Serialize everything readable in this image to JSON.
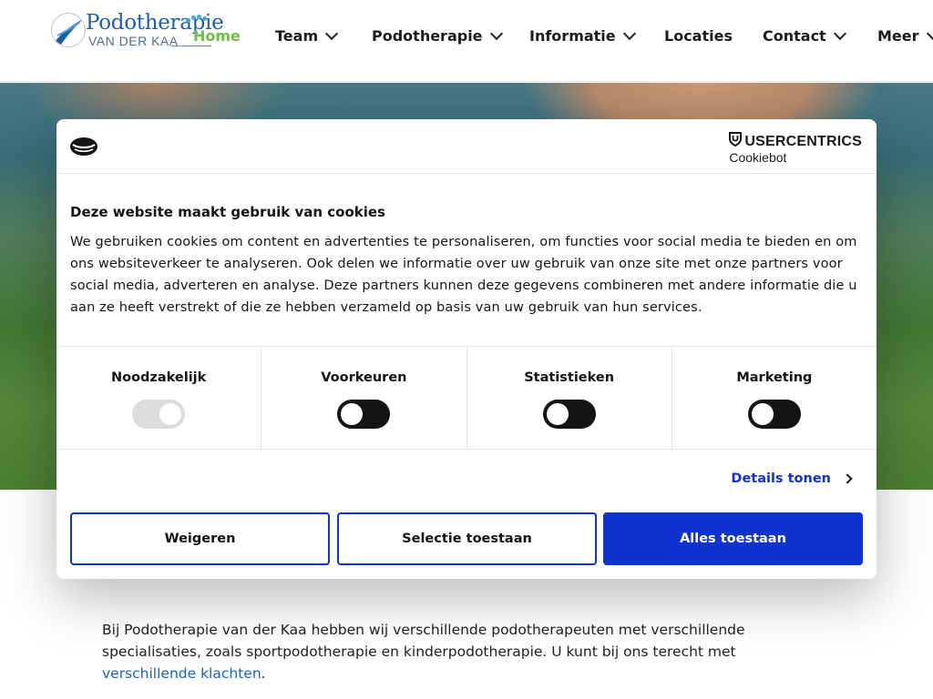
{
  "logo": {
    "title": "Podotherapie",
    "subtitle": "VAN DER KAA"
  },
  "nav": {
    "items": [
      {
        "label": "Home",
        "active": true
      },
      {
        "label": "Team"
      },
      {
        "label": "Podotherapie"
      },
      {
        "label": "Informatie"
      },
      {
        "label": "Locaties"
      },
      {
        "label": "Contact"
      },
      {
        "label": "Meer"
      }
    ]
  },
  "cookie_dialog": {
    "brand_top": "USERCENTRICS",
    "brand_bottom": "Cookiebot",
    "title": "Deze website maakt gebruik van cookies",
    "text": "We gebruiken cookies om content en advertenties te personaliseren, om functies voor social media te bieden en om ons websiteverkeer te analyseren. Ook delen we informatie over uw gebruik van onze site met onze partners voor social media, adverteren en analyse. Deze partners kunnen deze gegevens combineren met andere informatie die u aan ze heeft verstrekt of die ze hebben verzameld op basis van uw gebruik van hun services.",
    "toggles": [
      {
        "label": "Noodzakelijk",
        "state": "on-disabled"
      },
      {
        "label": "Voorkeuren",
        "state": "off"
      },
      {
        "label": "Statistieken",
        "state": "off"
      },
      {
        "label": "Marketing",
        "state": "off"
      }
    ],
    "details_label": "Details tonen",
    "buttons": {
      "deny": "Weigeren",
      "selection": "Selectie toestaan",
      "allow_all": "Alles toestaan"
    },
    "colors": {
      "accent": "#1032cf",
      "toggle_off": "#141414",
      "toggle_disabled": "#dcdcdc"
    }
  },
  "intro": {
    "text_before": "Bij Podotherapie van der Kaa hebben wij verschillende podotherapeuten met verschillende specialisaties, zoals sportpodotherapie en kinderpodotherapie. U kunt bij ons terecht met ",
    "link": "verschillende klachten",
    "text_after": "."
  }
}
